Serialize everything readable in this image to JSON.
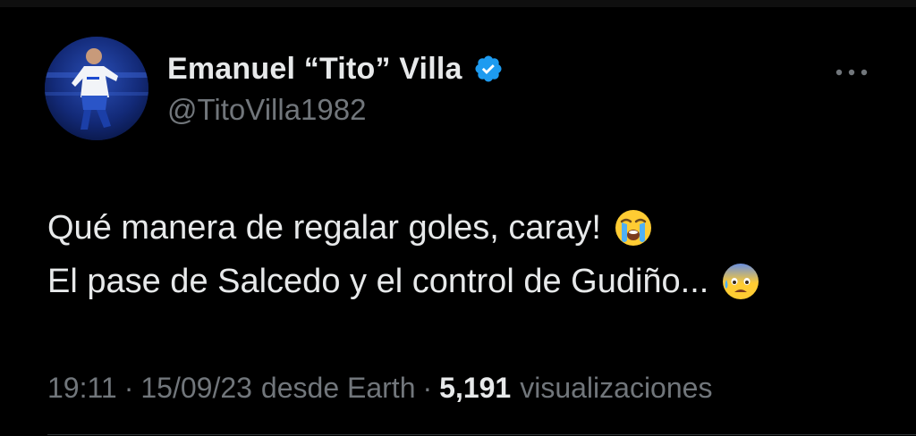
{
  "tweet": {
    "author": {
      "display_name": "Emanuel “Tito” Villa",
      "handle": "@TitoVilla1982",
      "verified_icon": "verified-badge-icon",
      "avatar_icon": "avatar"
    },
    "more_icon": "more-options-icon",
    "text_line_1": "Qué manera de regalar goles, caray!",
    "text_line_2": "El pase de Salcedo y el control de Gudiño...",
    "emoji_1": "loudly-crying-face-icon",
    "emoji_2": "anxious-face-with-sweat-icon",
    "meta": {
      "time": "19:11",
      "date": "15/09/23",
      "source": "desde Earth",
      "views_count": "5,191",
      "views_label": "visualizaciones"
    }
  },
  "colors": {
    "background": "#000000",
    "text_primary": "#e7e9ea",
    "text_secondary": "#71767b",
    "verified_blue": "#1d9bf0",
    "divider": "#2f3336"
  }
}
